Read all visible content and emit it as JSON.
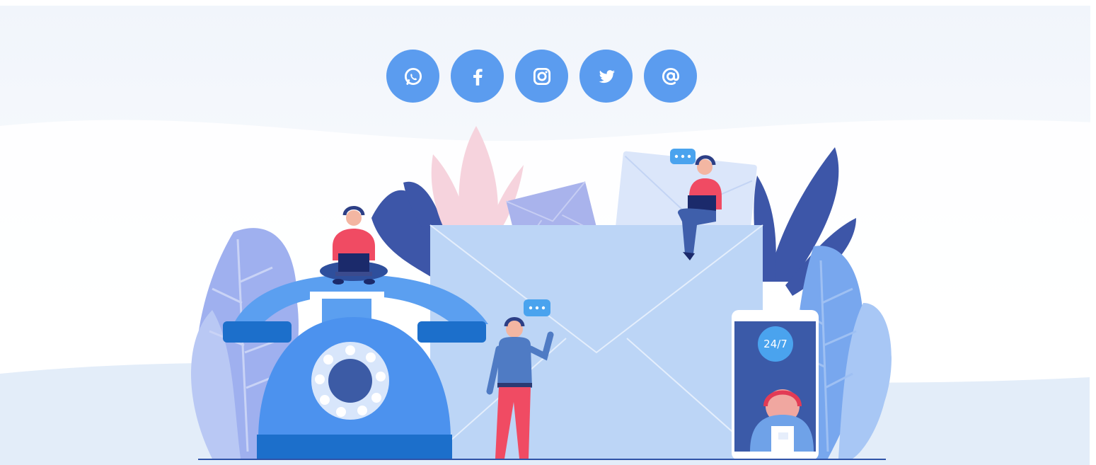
{
  "colors": {
    "sky_top": "#f3f6fb",
    "ground": "#dfeaf8",
    "accent": "#5b9cef",
    "phone_blue": "#4f8fe8",
    "dark_blue": "#2f53a8",
    "envelope": "#bcd5f6",
    "pink": "#f4c9d6",
    "red_shirt": "#f04b63"
  },
  "social": [
    {
      "name": "whatsapp",
      "icon": "whatsapp-icon"
    },
    {
      "name": "facebook",
      "icon": "facebook-icon"
    },
    {
      "name": "instagram",
      "icon": "instagram-icon"
    },
    {
      "name": "twitter",
      "icon": "twitter-icon"
    },
    {
      "name": "email",
      "icon": "at-icon"
    }
  ],
  "phone_badge": "24/7",
  "speech_bubble_text": "..."
}
